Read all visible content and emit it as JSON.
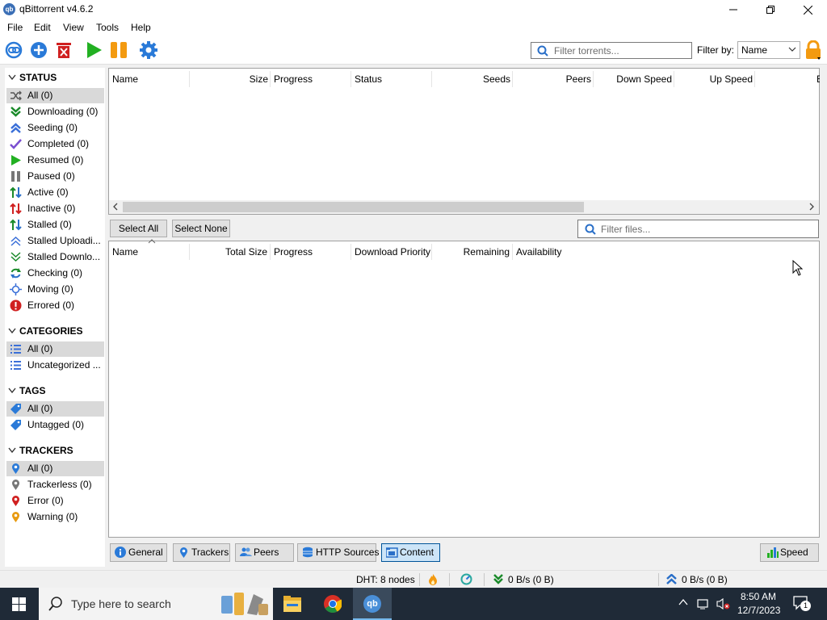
{
  "window": {
    "title": "qBittorrent v4.6.2",
    "app_icon_text": "qb"
  },
  "menu": [
    "File",
    "Edit",
    "View",
    "Tools",
    "Help"
  ],
  "toolbar": {
    "filter_placeholder": "Filter torrents...",
    "filter_by_label": "Filter by:",
    "filter_by_value": "Name",
    "icons": [
      "add-link-icon",
      "add-torrent-icon",
      "delete-icon",
      "resume-icon",
      "pause-icon",
      "options-icon",
      "lock-icon"
    ]
  },
  "sidebar": {
    "status": {
      "heading": "STATUS",
      "items": [
        {
          "label": "All (0)",
          "icon": "shuffle-icon",
          "color": "#555555",
          "selected": true
        },
        {
          "label": "Downloading (0)",
          "icon": "download-icon",
          "color": "#1a8a2a"
        },
        {
          "label": "Seeding (0)",
          "icon": "upload-icon",
          "color": "#3a6fd8"
        },
        {
          "label": "Completed (0)",
          "icon": "check-icon",
          "color": "#7a4fd0"
        },
        {
          "label": "Resumed (0)",
          "icon": "play-icon",
          "color": "#22b022"
        },
        {
          "label": "Paused (0)",
          "icon": "pause-icon",
          "color": "#777777"
        },
        {
          "label": "Active (0)",
          "icon": "active-icon",
          "color": "#1a8a2a"
        },
        {
          "label": "Inactive (0)",
          "icon": "inactive-icon",
          "color": "#d02020"
        },
        {
          "label": "Stalled (0)",
          "icon": "stalled-icon",
          "color": "#2a8a6a"
        },
        {
          "label": "Stalled Uploadi...",
          "icon": "stalled-upload-icon",
          "color": "#3a6fd8"
        },
        {
          "label": "Stalled Downlo...",
          "icon": "stalled-download-icon",
          "color": "#1a8a2a"
        },
        {
          "label": "Checking (0)",
          "icon": "refresh-icon",
          "color": "#1a8a2a"
        },
        {
          "label": "Moving (0)",
          "icon": "moving-icon",
          "color": "#3a6fd8"
        },
        {
          "label": "Errored (0)",
          "icon": "error-icon",
          "color": "#d02020"
        }
      ]
    },
    "categories": {
      "heading": "CATEGORIES",
      "items": [
        {
          "label": "All (0)",
          "icon": "list-icon",
          "color": "#3a6fd8",
          "selected": true
        },
        {
          "label": "Uncategorized ...",
          "icon": "list-icon",
          "color": "#3a6fd8"
        }
      ]
    },
    "tags": {
      "heading": "TAGS",
      "items": [
        {
          "label": "All (0)",
          "icon": "tag-icon",
          "color": "#2a7ad8",
          "selected": true
        },
        {
          "label": "Untagged (0)",
          "icon": "tag-icon",
          "color": "#2a7ad8"
        }
      ]
    },
    "trackers": {
      "heading": "TRACKERS",
      "items": [
        {
          "label": "All (0)",
          "icon": "pin-icon",
          "color": "#2a7ad8",
          "selected": true
        },
        {
          "label": "Trackerless (0)",
          "icon": "pin-icon",
          "color": "#777777"
        },
        {
          "label": "Error (0)",
          "icon": "pin-icon",
          "color": "#d02020"
        },
        {
          "label": "Warning (0)",
          "icon": "pin-icon",
          "color": "#e89a10"
        }
      ]
    }
  },
  "torrent_table": {
    "columns": [
      "Name",
      "Size",
      "Progress",
      "Status",
      "Seeds",
      "Peers",
      "Down Speed",
      "Up Speed",
      "E"
    ]
  },
  "content": {
    "select_all": "Select All",
    "select_none": "Select None",
    "filter_placeholder": "Filter files...",
    "columns": [
      "Name",
      "Total Size",
      "Progress",
      "Download Priority",
      "Remaining",
      "Availability"
    ]
  },
  "tabs": [
    {
      "label": "General",
      "icon": "info-icon"
    },
    {
      "label": "Trackers",
      "icon": "pin-icon"
    },
    {
      "label": "Peers",
      "icon": "peers-icon"
    },
    {
      "label": "HTTP Sources",
      "icon": "server-icon"
    },
    {
      "label": "Content",
      "icon": "folder-icon",
      "active": true
    }
  ],
  "speed_button": "Speed",
  "statusbar": {
    "dht": "DHT: 8 nodes",
    "download": "0 B/s (0 B)",
    "upload": "0 B/s (0 B)"
  },
  "taskbar": {
    "search_placeholder": "Type here to search",
    "time": "8:50 AM",
    "date": "12/7/2023",
    "notification_count": "1"
  }
}
